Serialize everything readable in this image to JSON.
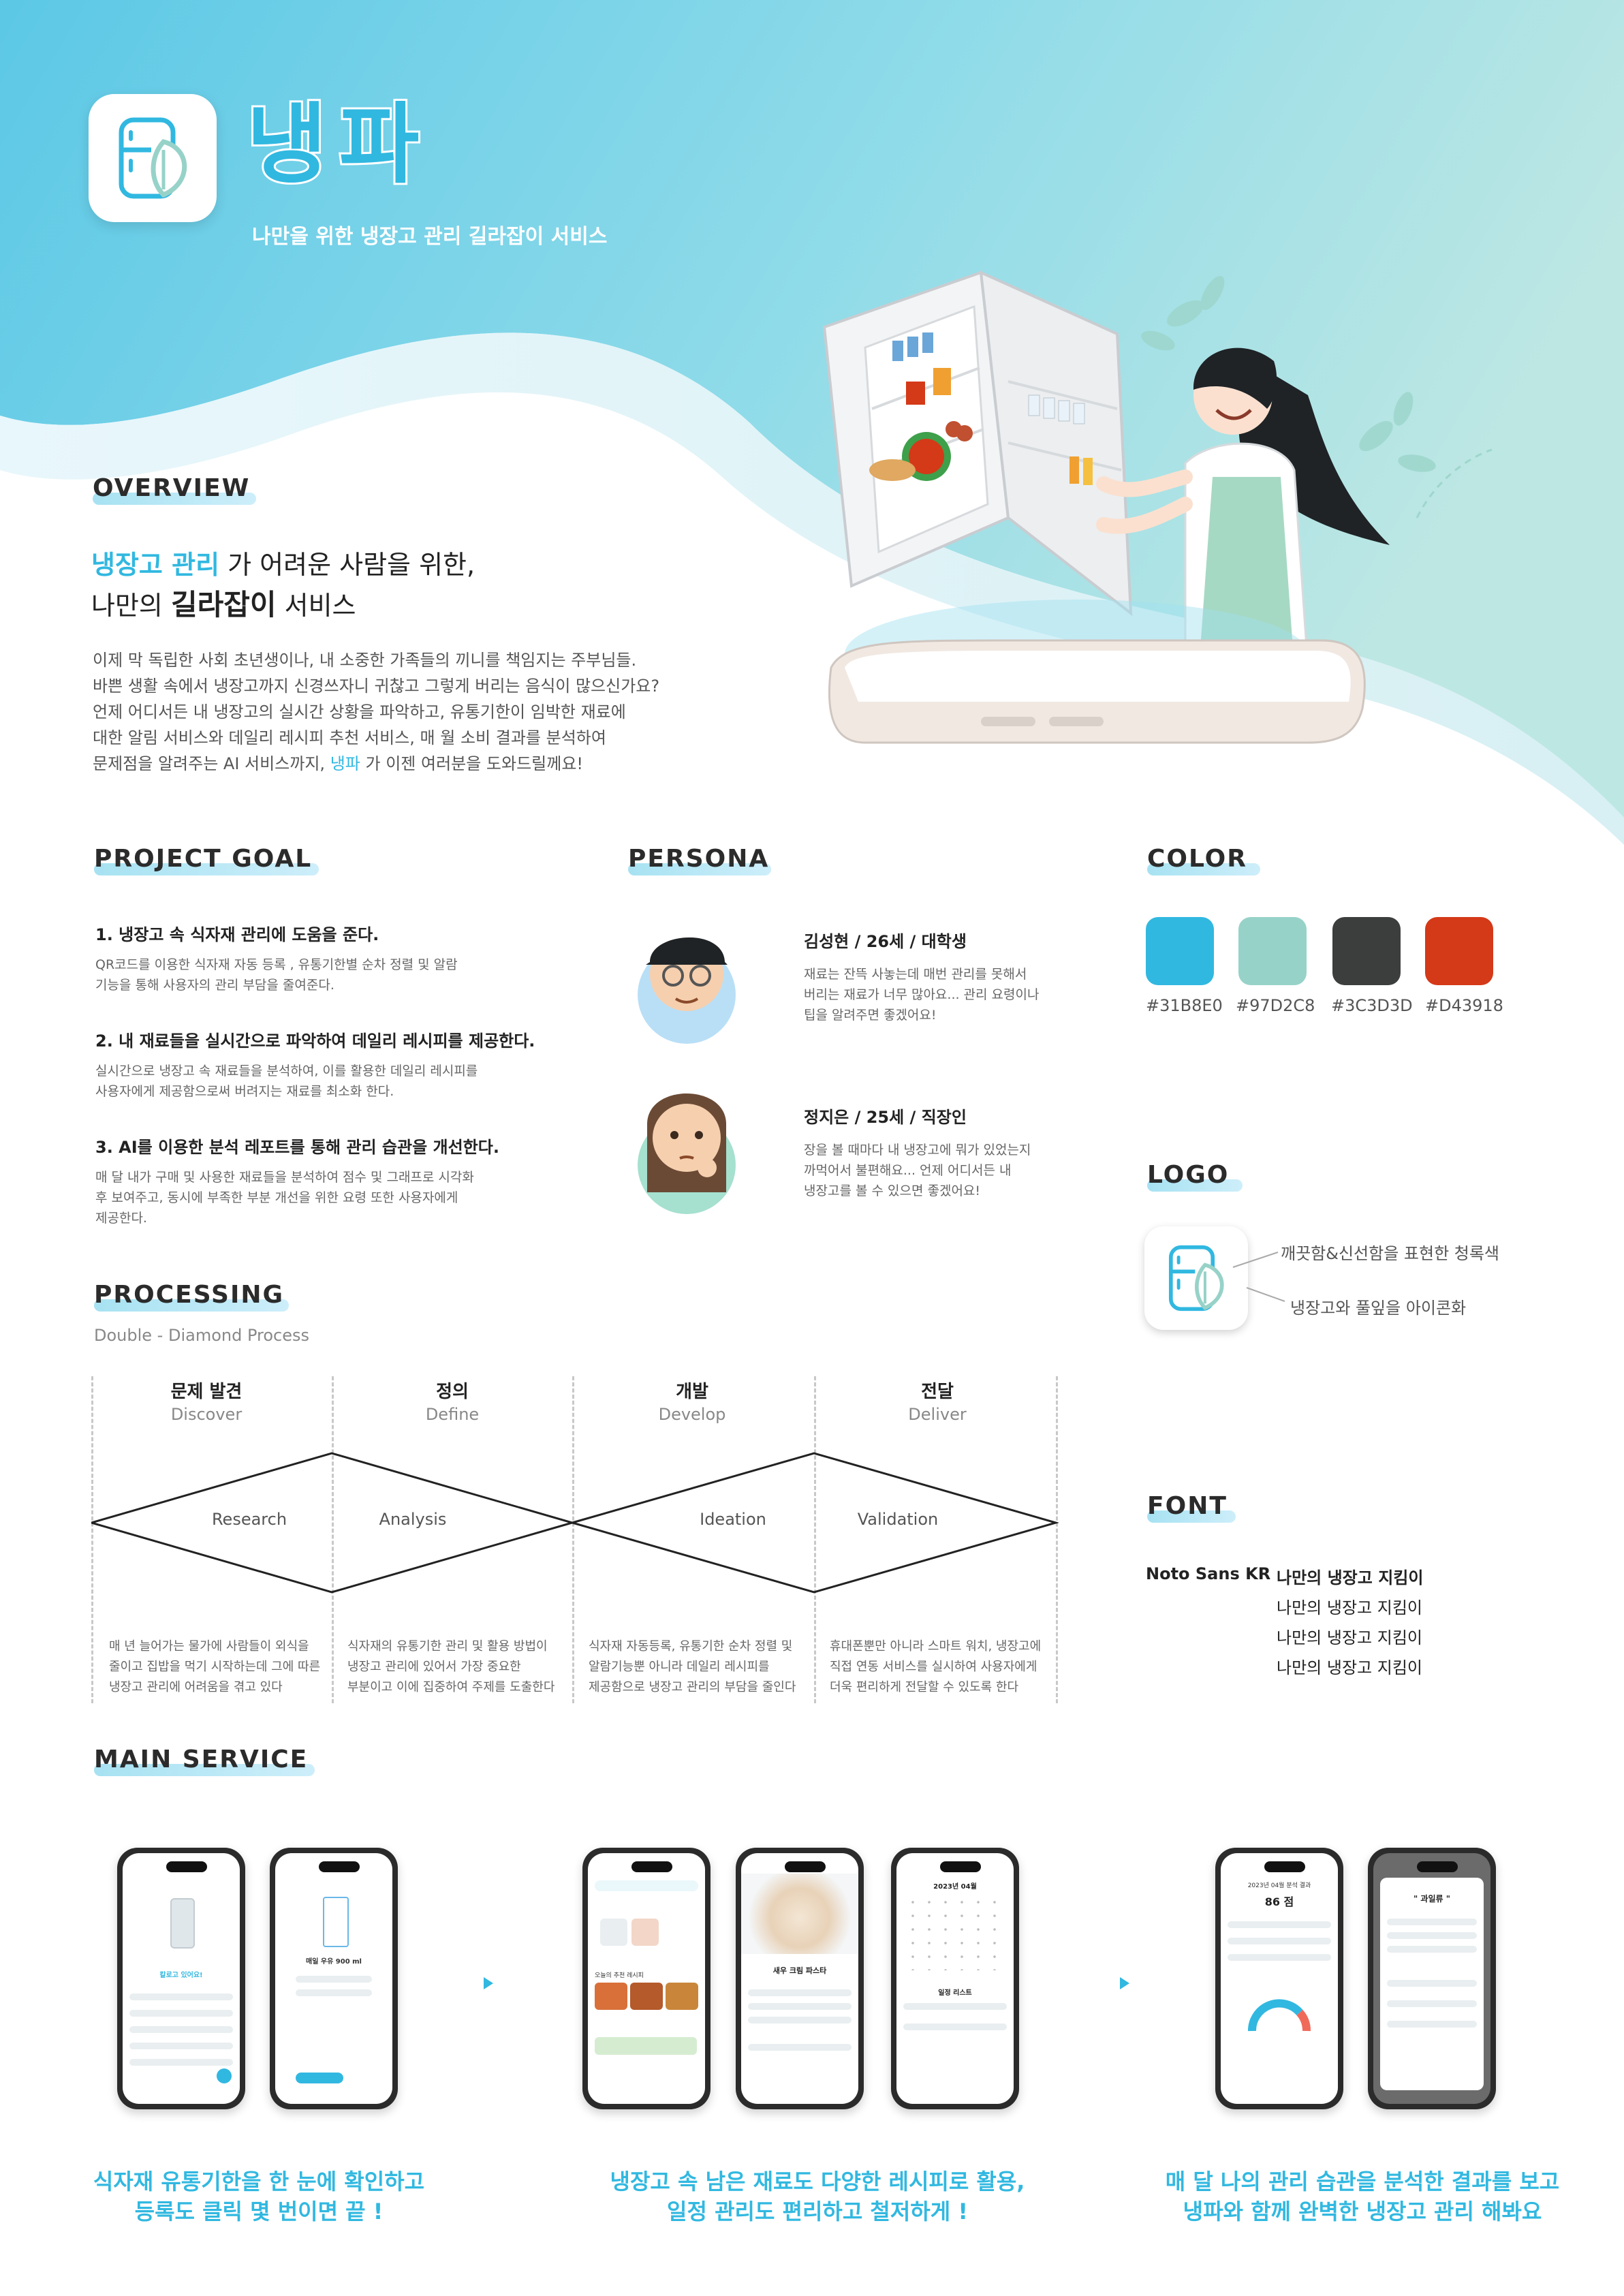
{
  "brand": {
    "name": "냉파",
    "subtitle": "나만을 위한 냉장고 관리 길라잡이 서비스"
  },
  "overview": {
    "title": "OVERVIEW",
    "headline_accent": "냉장고 관리",
    "headline_rest": " 가 어려운 사람을 위한,",
    "headline2_prefix": "나만의 ",
    "headline2_strong": "길라잡이",
    "headline2_suffix": " 서비스",
    "body_lines": [
      "이제 막 독립한 사회 초년생이나, 내 소중한 가족들의 끼니를 책임지는 주부님들.",
      "바쁜 생활 속에서 냉장고까지 신경쓰자니 귀찮고 그렇게 버리는 음식이 많으신가요?",
      "언제 어디서든 내 냉장고의 실시간 상황을 파악하고, 유통기한이 임박한 재료에",
      "대한 알림 서비스와 데일리 레시피 추천 서비스, 매 월 소비 결과를 분석하여"
    ],
    "body_last_prefix": "문제점을 알려주는 AI 서비스까지, ",
    "body_last_accent": "냉파",
    "body_last_suffix": " 가 이젠 여러분을 도와드릴께요!"
  },
  "project_goal": {
    "title": "PROJECT GOAL",
    "goals": [
      {
        "heading": "1. 냉장고 속 식자재 관리에 도움을 준다.",
        "lines": [
          "QR코드를 이용한 식자재 자동 등록 , 유통기한별 순차 정렬 및 알람",
          "기능을 통해 사용자의 관리 부담을 줄여준다."
        ]
      },
      {
        "heading": "2. 내 재료들을 실시간으로 파악하여 데일리 레시피를 제공한다.",
        "lines": [
          "실시간으로 냉장고 속 재료들을 분석하여, 이를 활용한 데일리 레시피를",
          "사용자에게 제공함으로써 버려지는 재료를 최소화 한다."
        ]
      },
      {
        "heading": "3. AI를 이용한 분석 레포트를 통해 관리 습관을 개선한다.",
        "lines": [
          "매 달 내가 구매 및 사용한 재료들을 분석하여 점수 및 그래프로 시각화",
          "후 보여주고, 동시에 부족한 부분 개선을 위한 요령 또한 사용자에게",
          "제공한다."
        ]
      }
    ]
  },
  "persona": {
    "title": "PERSONA",
    "people": [
      {
        "name": "김성현 / 26세 / 대학생",
        "lines": [
          "재료는 잔뜩 사놓는데 매번 관리를 못해서",
          "버리는 재료가 너무 많아요... 관리 요령이나",
          "팁을 알려주면 좋겠어요!"
        ]
      },
      {
        "name": "정지은 / 25세 / 직장인",
        "lines": [
          "장을 볼 때마다 내 냉장고에 뭐가 있었는지",
          "까먹어서 불편해요... 언제 어디서든 내",
          "냉장고를 볼 수 있으면 좋겠어요!"
        ]
      }
    ]
  },
  "color": {
    "title": "COLOR",
    "swatches": [
      {
        "hex": "#31B8E0",
        "label": "#31B8E0"
      },
      {
        "hex": "#97D2C8",
        "label": "#97D2C8"
      },
      {
        "hex": "#3C3D3D",
        "label": "#3C3D3D"
      },
      {
        "hex": "#D43918",
        "label": "#D43918"
      }
    ]
  },
  "logo": {
    "title": "LOGO",
    "note1": "깨끗함&신선함을 표현한 청록색",
    "note2": "냉장고와 풀잎을 아이콘화"
  },
  "font": {
    "title": "FONT",
    "name": "Noto Sans KR",
    "samples": [
      "나만의 냉장고 지킴이",
      "나만의 냉장고 지킴이",
      "나만의 냉장고 지킴이",
      "나만의 냉장고 지킴이"
    ]
  },
  "processing": {
    "title": "PROCESSING",
    "subtitle": "Double - Diamond Process",
    "stages": [
      {
        "ko": "문제 발견",
        "en": "Discover"
      },
      {
        "ko": "정의",
        "en": "Define"
      },
      {
        "ko": "개발",
        "en": "Develop"
      },
      {
        "ko": "전달",
        "en": "Deliver"
      }
    ],
    "diamond_labels": [
      "Research",
      "Analysis",
      "Ideation",
      "Validation"
    ],
    "descriptions": [
      [
        "매 년 늘어가는 물가에 사람들이 외식을",
        "줄이고 집밥을 먹기 시작하는데 그에 따른",
        "냉장고 관리에 어려움을 겪고 있다"
      ],
      [
        "식자재의 유통기한 관리 및 활용 방법이",
        "냉장고 관리에 있어서 가장 중요한",
        "부분이고 이에 집중하여 주제를 도출한다"
      ],
      [
        "식자재 자동등록, 유통기한 순차 정렬 및",
        "알람기능뿐 아니라 데일리 레시피를",
        "제공함으로 냉장고 관리의 부담을 줄인다"
      ],
      [
        "휴대폰뿐만 아니라 스마트 워치,  냉장고에",
        "직접 연동 서비스를 실시하여 사용자에게",
        "더욱 편리하게 전달할 수 있도록 한다"
      ]
    ]
  },
  "main_service": {
    "title": "MAIN SERVICE",
    "captions": [
      [
        "식자재 유통기한을 한 눈에 확인하고",
        "등록도 클릭 몇 번이면 끝 !"
      ],
      [
        "냉장고 속 남은 재료도 다양한 레시피로 활용,",
        "일정 관리도 편리하고 철저하게 !"
      ],
      [
        "매 달 나의 관리 습관을 분석한 결과를 보고",
        "냉파와 함께 완벽한 냉장고 관리 해봐요"
      ]
    ],
    "phone_texts": {
      "p1_title": "칼로고 있어요!",
      "p2_item": "매일 우유 900 ml",
      "p3_label": "오늘의 추천 레시피",
      "p4_recipe": "새우 크림 파스타",
      "p5_month": "2023년 04월",
      "p5_list": "일정 리스트",
      "p6_title": "2023년 04월 분석 결과",
      "p6_score": "86 점",
      "p7_title": "\" 과일류 \""
    }
  }
}
